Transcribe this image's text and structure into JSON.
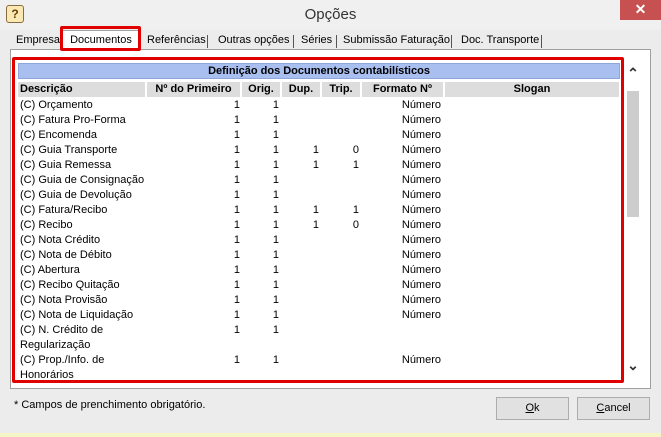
{
  "window": {
    "title": "Opções",
    "close_glyph": "✕",
    "app_icon_glyph": "?"
  },
  "tabs": [
    {
      "label": "Empresa",
      "active": false
    },
    {
      "label": "Documentos",
      "active": true
    },
    {
      "label": "Referências",
      "active": false
    },
    {
      "label": "Outras opções",
      "active": false
    },
    {
      "label": "Séries",
      "active": false
    },
    {
      "label": "Submissão Faturação",
      "active": false
    },
    {
      "label": "Doc. Transporte",
      "active": false
    }
  ],
  "grid": {
    "caption": "Definição dos Documentos contabilísticos",
    "columns": [
      "Descrição",
      "Nº do Primeiro",
      "Orig.",
      "Dup.",
      "Trip.",
      "Formato Nº",
      "Slogan"
    ],
    "rows": [
      {
        "desc": "(C) Orçamento",
        "primeiro": "1",
        "orig": "1",
        "dup": "",
        "trip": "",
        "formato": "Número",
        "slogan": ""
      },
      {
        "desc": "(C) Fatura Pro-Forma",
        "primeiro": "1",
        "orig": "1",
        "dup": "",
        "trip": "",
        "formato": "Número",
        "slogan": ""
      },
      {
        "desc": "(C) Encomenda",
        "primeiro": "1",
        "orig": "1",
        "dup": "",
        "trip": "",
        "formato": "Número",
        "slogan": ""
      },
      {
        "desc": "(C) Guia Transporte",
        "primeiro": "1",
        "orig": "1",
        "dup": "1",
        "trip": "0",
        "formato": "Número",
        "slogan": ""
      },
      {
        "desc": "(C) Guia Remessa",
        "primeiro": "1",
        "orig": "1",
        "dup": "1",
        "trip": "1",
        "formato": "Número",
        "slogan": ""
      },
      {
        "desc": "(C) Guia de Consignação",
        "primeiro": "1",
        "orig": "1",
        "dup": "",
        "trip": "",
        "formato": "Número",
        "slogan": ""
      },
      {
        "desc": "(C) Guia de Devolução",
        "primeiro": "1",
        "orig": "1",
        "dup": "",
        "trip": "",
        "formato": "Número",
        "slogan": ""
      },
      {
        "desc": "(C) Fatura/Recibo",
        "primeiro": "1",
        "orig": "1",
        "dup": "1",
        "trip": "1",
        "formato": "Número",
        "slogan": ""
      },
      {
        "desc": "(C) Recibo",
        "primeiro": "1",
        "orig": "1",
        "dup": "1",
        "trip": "0",
        "formato": "Número",
        "slogan": ""
      },
      {
        "desc": "(C) Nota Crédito",
        "primeiro": "1",
        "orig": "1",
        "dup": "",
        "trip": "",
        "formato": "Número",
        "slogan": ""
      },
      {
        "desc": "(C) Nota de Débito",
        "primeiro": "1",
        "orig": "1",
        "dup": "",
        "trip": "",
        "formato": "Número",
        "slogan": ""
      },
      {
        "desc": "(C) Abertura",
        "primeiro": "1",
        "orig": "1",
        "dup": "",
        "trip": "",
        "formato": "Número",
        "slogan": ""
      },
      {
        "desc": "(C) Recibo Quitação",
        "primeiro": "1",
        "orig": "1",
        "dup": "",
        "trip": "",
        "formato": "Número",
        "slogan": ""
      },
      {
        "desc": "(C) Nota Provisão",
        "primeiro": "1",
        "orig": "1",
        "dup": "",
        "trip": "",
        "formato": "Número",
        "slogan": ""
      },
      {
        "desc": "(C) Nota de Liquidação",
        "primeiro": "1",
        "orig": "1",
        "dup": "",
        "trip": "",
        "formato": "Número",
        "slogan": ""
      },
      {
        "desc": "(C) N. Crédito de Regularização",
        "primeiro": "1",
        "orig": "1",
        "dup": "",
        "trip": "",
        "formato": "",
        "slogan": "",
        "tall": true
      },
      {
        "desc": "(C) Prop./Info. de Honorários",
        "primeiro": "1",
        "orig": "1",
        "dup": "",
        "trip": "",
        "formato": "Número",
        "slogan": "",
        "tall": true
      }
    ]
  },
  "scrollbar": {
    "up_glyph": "⌃",
    "down_glyph": "⌄"
  },
  "footer": {
    "note": "* Campos de prenchimento obrigatório.",
    "ok": {
      "hot": "O",
      "rest": "k"
    },
    "cancel": {
      "hot": "C",
      "rest": "ancel"
    }
  },
  "colors": {
    "highlight": "#e00000",
    "caption_bg": "#a8bff0",
    "close_bg": "#c75050"
  }
}
